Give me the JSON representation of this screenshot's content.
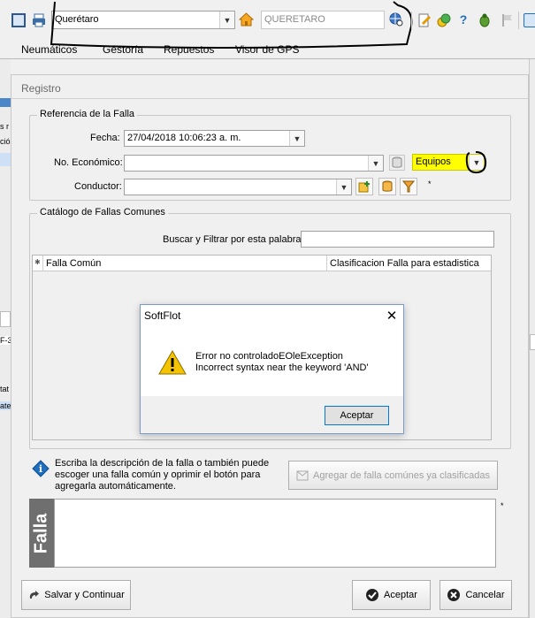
{
  "toolbar": {
    "location_combo_value": "Querétaro",
    "location_field_value": "QUERETARO"
  },
  "menu": {
    "items": [
      "Neumáticos",
      "Gestoría",
      "Repuestos",
      "Visor de GPS"
    ]
  },
  "left_strip": {
    "texts": [
      "s r",
      "ció",
      "F-3",
      "tat",
      "ate"
    ]
  },
  "dialog": {
    "title": "Registro",
    "reference_group": {
      "title": "Referencia de la Falla",
      "fecha_label": "Fecha:",
      "fecha_value": "27/04/2018 10:06:23 a. m.",
      "economico_label": "No. Económico:",
      "economico_value": "",
      "equipos_value": "Equipos",
      "conductor_label": "Conductor:",
      "conductor_value": "",
      "required_mark": "*"
    },
    "catalog_group": {
      "title": "Catálogo de Fallas Comunes",
      "search_label": "Buscar y Filtrar por esta palabra:",
      "search_value": "",
      "columns": [
        "Falla Común",
        "Clasificacion Falla para estadistica"
      ],
      "col_marker": "✱"
    },
    "info_text": "Escriba la descripción de la falla o  también puede escoger una falla común y oprimir el botón para agregarla automáticamente.",
    "add_common_button": "Agregar de falla comúnes ya clasificadas",
    "falla_side_label": "Falla",
    "falla_required_mark": "*",
    "save_continue_button": "Salvar y Continuar",
    "accept_button": "Aceptar",
    "cancel_button": "Cancelar"
  },
  "error_box": {
    "title": "SoftFlot",
    "line1": "Error no controladoEOleException",
    "line2": "Incorrect syntax near the keyword 'AND'",
    "ok_button": "Aceptar"
  },
  "colors": {
    "equipos_bg": "#ffff00",
    "annotation": "#000000",
    "accent": "#1e6fc0"
  }
}
